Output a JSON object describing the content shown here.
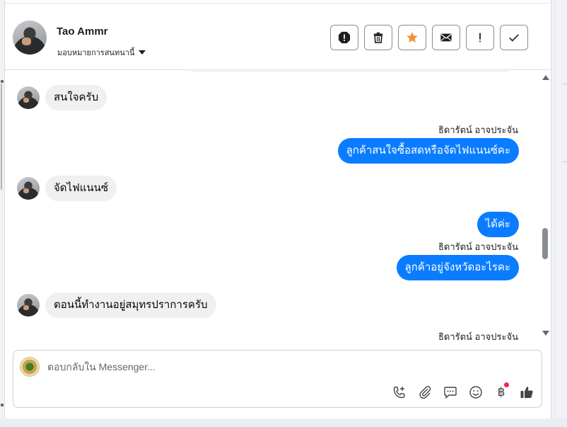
{
  "header": {
    "contact_name": "Tao Ammr",
    "assign_label": "มอบหมายการสนทนานี้",
    "actions": [
      {
        "name": "report-button",
        "icon": "alert-circle-icon"
      },
      {
        "name": "delete-button",
        "icon": "trash-icon"
      },
      {
        "name": "star-button",
        "icon": "star-icon"
      },
      {
        "name": "mark-unread-button",
        "icon": "envelope-icon"
      },
      {
        "name": "spam-button",
        "icon": "exclamation-icon"
      },
      {
        "name": "done-button",
        "icon": "check-icon"
      }
    ]
  },
  "messages": [
    {
      "direction": "in",
      "text": "สนใจครับ"
    },
    {
      "direction": "out",
      "sender": "ธิดารัตน์ อาจประจัน",
      "text": "ลูกค้าสนใจซื้อสดหรือจัดไฟแนนซ์คะ"
    },
    {
      "direction": "in",
      "text": "จัดไฟแนนซ์"
    },
    {
      "direction": "out",
      "text": "ได้ค่ะ"
    },
    {
      "direction": "out",
      "sender": "ธิดารัตน์ อาจประจัน",
      "text": "ลูกค้าอยู่จังหวัดอะไรคะ"
    },
    {
      "direction": "in",
      "text": "ตอนนี้ทำงานอยู่สมุทรปราการครับ"
    },
    {
      "direction": "out",
      "sender": "ธิดารัตน์ อาจประจัน"
    }
  ],
  "composer": {
    "placeholder": "ตอบกลับใน Messenger...",
    "value": "",
    "tools": [
      "phone-add-icon",
      "paperclip-icon",
      "chat-bubble-icon",
      "smiley-icon",
      "baht-icon",
      "thumbs-up-icon"
    ],
    "baht_symbol": "฿"
  },
  "colors": {
    "accent": "#0a7cff",
    "star": "#f5923e",
    "incoming_bubble": "#f0f0f0",
    "notification_dot": "#f02849"
  }
}
